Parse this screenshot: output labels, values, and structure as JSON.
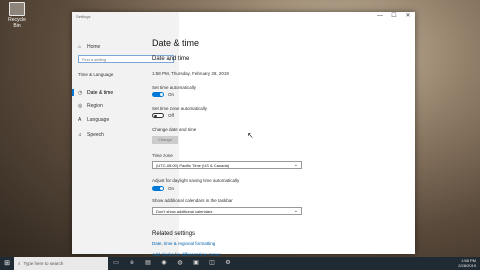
{
  "desktop": {
    "recycle_bin_label": "Recycle Bin"
  },
  "window": {
    "title": "Settings",
    "controls": {
      "minimize": "—",
      "maximize": "☐",
      "close": "✕"
    }
  },
  "sidebar": {
    "home_label": "Home",
    "search_placeholder": "Find a setting",
    "section_title": "Time & Language",
    "items": [
      {
        "icon": "calendar-clock-icon",
        "label": "Date & time"
      },
      {
        "icon": "globe-icon",
        "label": "Region"
      },
      {
        "icon": "language-icon",
        "label": "Language"
      },
      {
        "icon": "microphone-icon",
        "label": "Speech"
      }
    ]
  },
  "main": {
    "page_title": "Date & time",
    "section_title": "Date and time",
    "current_time": "1:58 PM, Thursday, February 28, 2019",
    "set_time_auto": {
      "label": "Set time automatically",
      "state": "On",
      "on": true
    },
    "set_timezone_auto": {
      "label": "Set time zone automatically",
      "state": "Off",
      "on": false
    },
    "change_date_time": {
      "label": "Change date and time",
      "button": "Change"
    },
    "time_zone": {
      "label": "Time zone",
      "value": "(UTC-08:00) Pacific Time (US & Canada)"
    },
    "dst": {
      "label": "Adjust for daylight saving time automatically",
      "state": "On",
      "on": true
    },
    "additional_calendars": {
      "label": "Show additional calendars in the taskbar",
      "value": "Don't show additional calendars"
    },
    "related": {
      "title": "Related settings",
      "links": [
        "Date, time & regional formatting",
        "Add clocks for different time zones"
      ]
    }
  },
  "taskbar": {
    "start_icon": "windows-logo-icon",
    "search_placeholder": "Type here to search",
    "tray_time": "1:58 PM",
    "tray_date": "2/28/2019"
  }
}
